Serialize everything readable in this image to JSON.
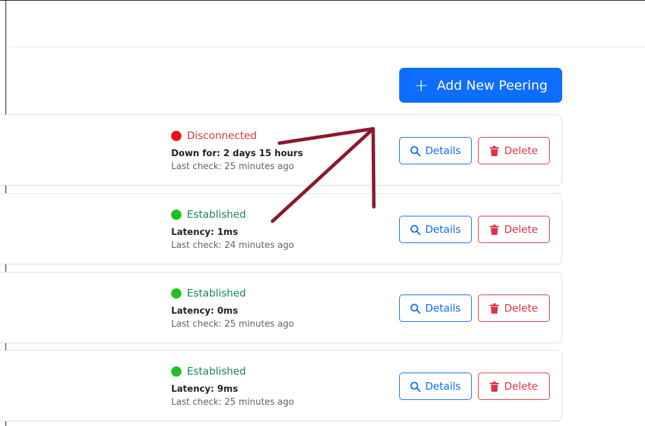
{
  "toolbar": {
    "add_label": "Add New Peering"
  },
  "peerings": [
    {
      "status": "Disconnected",
      "status_color": "#e61c1c",
      "metric": "Down for: 2 days 15 hours",
      "last_check": "Last check: 25 minutes ago"
    },
    {
      "status": "Established",
      "status_color": "#198754",
      "metric": "Latency: 1ms",
      "last_check": "Last check: 24 minutes ago"
    },
    {
      "status": "Established",
      "status_color": "#198754",
      "metric": "Latency: 0ms",
      "last_check": "Last check: 25 minutes ago"
    },
    {
      "status": "Established",
      "status_color": "#198754",
      "metric": "Latency: 9ms",
      "last_check": "Last check: 25 minutes ago"
    }
  ],
  "actions": {
    "details_label": "Details",
    "delete_label": "Delete"
  },
  "colors": {
    "primary": "#0d6efd",
    "danger": "#dc3545",
    "success_dot": "#1fbf1f",
    "error_dot": "#f20e0e",
    "annotation": "#8b1a2e"
  },
  "icons": {
    "add": "plus-icon",
    "details": "search-icon",
    "delete": "trash-icon"
  }
}
